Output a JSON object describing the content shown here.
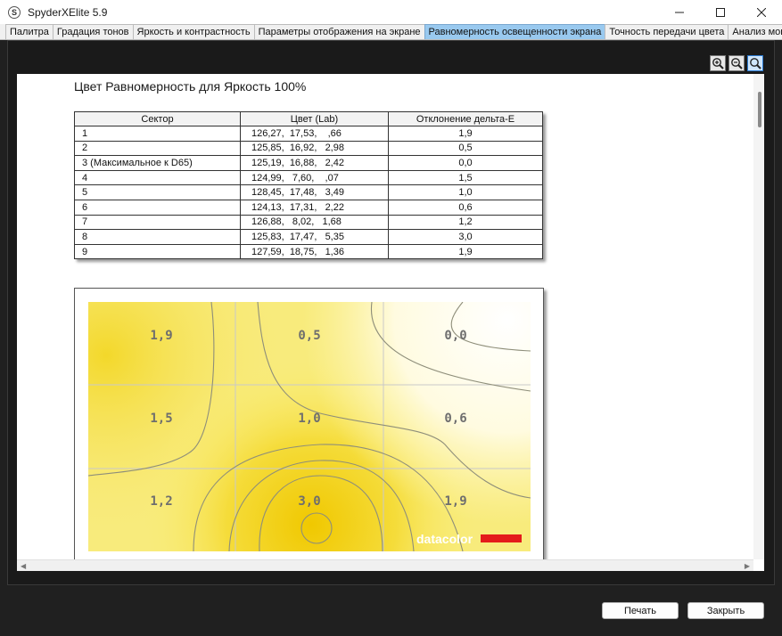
{
  "window": {
    "title": "SpyderXElite 5.9",
    "icon": "S"
  },
  "tabs": [
    {
      "label": "Палитра"
    },
    {
      "label": "Градация тонов"
    },
    {
      "label": "Яркость и контрастность"
    },
    {
      "label": "Параметры отображения на экране"
    },
    {
      "label": "Равномерность освещенности экрана"
    },
    {
      "label": "Точность передачи цвета"
    },
    {
      "label": "Анализ монитора"
    }
  ],
  "report": {
    "title": "Цвет Равномерность для Яркость 100%",
    "table": {
      "headers": [
        "Сектор",
        "Цвет (Lab)",
        "Отклонение дельта-E"
      ],
      "rows": [
        {
          "sector": "1",
          "lab": "126,27,  17,53,    ,66",
          "de": "1,9"
        },
        {
          "sector": "2",
          "lab": "125,85,  16,92,   2,98",
          "de": "0,5"
        },
        {
          "sector": "3 (Максимальное к D65)",
          "lab": "125,19,  16,88,   2,42",
          "de": "0,0"
        },
        {
          "sector": "4",
          "lab": "124,99,   7,60,    ,07",
          "de": "1,5"
        },
        {
          "sector": "5",
          "lab": "128,45,  17,48,   3,49",
          "de": "1,0"
        },
        {
          "sector": "6",
          "lab": "124,13,  17,31,   2,22",
          "de": "0,6"
        },
        {
          "sector": "7",
          "lab": "126,88,   8,02,   1,68",
          "de": "1,2"
        },
        {
          "sector": "8",
          "lab": "125,83,  17,47,   5,35",
          "de": "3,0"
        },
        {
          "sector": "9",
          "lab": "127,59,  18,75,   1,36",
          "de": "1,9"
        }
      ]
    },
    "map": {
      "cells": [
        "1,9",
        "0,5",
        "0,0",
        "1,5",
        "1,0",
        "0,6",
        "1,2",
        "3,0",
        "1,9"
      ],
      "brand": "datacolor",
      "colors": {
        "high": "#f0c800",
        "low": "#ffffff",
        "brand_bar": "#e41b1b"
      }
    }
  },
  "buttons": {
    "print": "Печать",
    "close": "Закрыть"
  }
}
